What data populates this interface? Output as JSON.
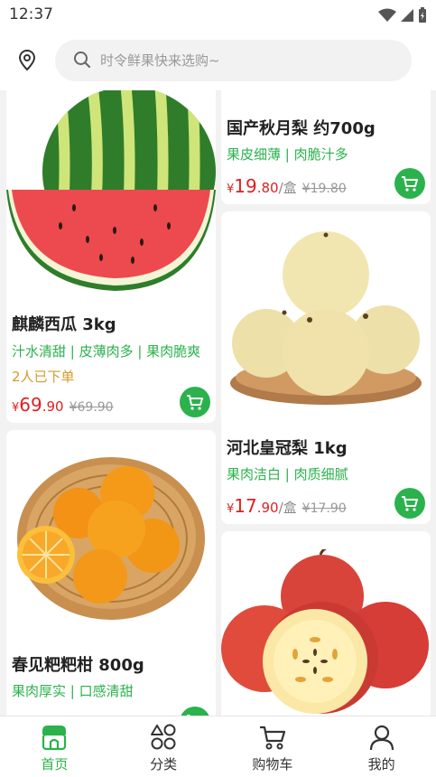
{
  "status": {
    "time": "12:37"
  },
  "search": {
    "placeholder": "时令鲜果快来选购~"
  },
  "products": [
    {
      "id": "watermelon",
      "title": "麒麟西瓜 3kg",
      "tags": "汁水清甜 | 皮薄肉多 | 果肉脆爽",
      "sold": "2人已下单",
      "currency": "¥",
      "price_int": "69",
      "price_dec": ".90",
      "unit": "",
      "old_price": "¥69.90"
    },
    {
      "id": "autumn-pear",
      "title": "国产秋月梨 约700g",
      "tags": "果皮细薄 | 肉脆汁多",
      "sold": "",
      "currency": "¥",
      "price_int": "19",
      "price_dec": ".80",
      "unit": "/盒",
      "old_price": "¥19.80"
    },
    {
      "id": "hebei-pear",
      "title": "河北皇冠梨 1kg",
      "tags": "果肉洁白 | 肉质细腻",
      "sold": "",
      "currency": "¥",
      "price_int": "17",
      "price_dec": ".90",
      "unit": "/盒",
      "old_price": "¥17.90"
    },
    {
      "id": "tangerine",
      "title": "春见粑粑柑 800g",
      "tags": "果肉厚实 | 口感清甜",
      "sold": "",
      "currency": "",
      "price_int": "",
      "price_dec": "",
      "unit": "",
      "old_price": ""
    },
    {
      "id": "apple",
      "title": "",
      "tags": "",
      "sold": "",
      "currency": "",
      "price_int": "",
      "price_dec": "",
      "unit": "",
      "old_price": ""
    }
  ],
  "tabbar": [
    {
      "label": "首页",
      "icon": "home-shop-icon",
      "active": true
    },
    {
      "label": "分类",
      "icon": "category-icon",
      "active": false
    },
    {
      "label": "购物车",
      "icon": "cart-icon",
      "active": false
    },
    {
      "label": "我的",
      "icon": "user-icon",
      "active": false
    }
  ],
  "colors": {
    "accent": "#2bb24c",
    "price": "#e02020",
    "sold": "#d49a2a"
  }
}
